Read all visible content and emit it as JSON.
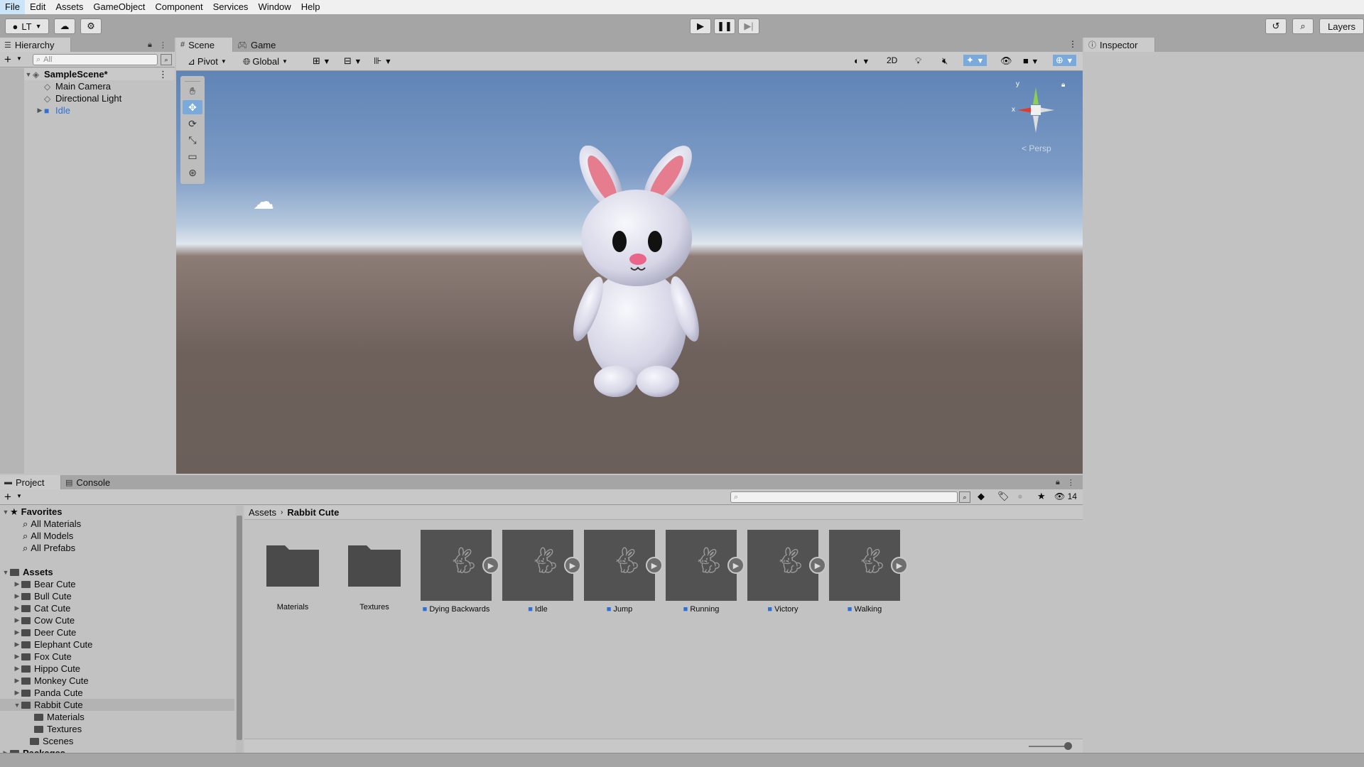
{
  "menu": [
    "File",
    "Edit",
    "Assets",
    "GameObject",
    "Component",
    "Services",
    "Window",
    "Help"
  ],
  "toolbar": {
    "account_label": "LT",
    "layers_label": "Layers"
  },
  "hierarchy": {
    "tab_label": "Hierarchy",
    "search_placeholder": "All",
    "scene_name": "SampleScene*",
    "items": [
      "Main Camera",
      "Directional Light",
      "Idle"
    ]
  },
  "scene_view": {
    "tab_scene": "Scene",
    "tab_game": "Game",
    "pivot_label": "Pivot",
    "global_label": "Global",
    "mode_2d": "2D",
    "gizmo_persp": "< Persp",
    "gizmo_y": "y",
    "gizmo_x": "x"
  },
  "inspector": {
    "tab_label": "Inspector"
  },
  "project": {
    "tab_project": "Project",
    "tab_console": "Console",
    "favorites_label": "Favorites",
    "favorites": [
      "All Materials",
      "All Models",
      "All Prefabs"
    ],
    "assets_label": "Assets",
    "asset_folders": [
      "Bear Cute",
      "Bull Cute",
      "Cat Cute",
      "Cow Cute",
      "Deer Cute",
      "Elephant Cute",
      "Fox Cute",
      "Hippo Cute",
      "Monkey Cute",
      "Panda Cute",
      "Rabbit Cute"
    ],
    "rabbit_children": [
      "Materials",
      "Textures"
    ],
    "scenes_label": "Scenes",
    "packages_label": "Packages",
    "breadcrumb_root": "Assets",
    "breadcrumb_current": "Rabbit Cute",
    "hidden_count": "14",
    "grid_folders": [
      "Materials",
      "Textures"
    ],
    "grid_animations": [
      "Dying Backwards",
      "Idle",
      "Jump",
      "Running",
      "Victory",
      "Walking"
    ]
  },
  "colors": {
    "selection_blue": "#2d6fd6",
    "panel_bg": "#c2c2c2",
    "tab_strip": "#a5a5a5"
  }
}
